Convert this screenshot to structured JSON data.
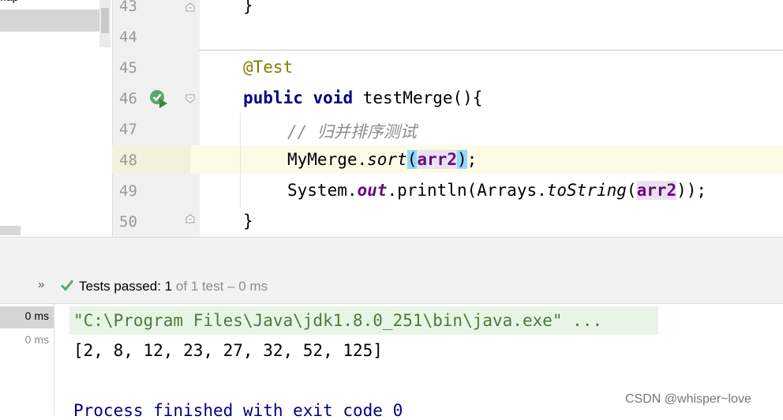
{
  "project_tree": {
    "partial_item": "nap"
  },
  "gutter": {
    "line_numbers": [
      "43",
      "44",
      "45",
      "46",
      "47",
      "48",
      "49",
      "50"
    ]
  },
  "editor": {
    "line43": {
      "brace": "}"
    },
    "line45": {
      "annotation": "@Test"
    },
    "line46": {
      "kw_public": "public",
      "kw_void": "void",
      "signature": " testMerge(){"
    },
    "line47": {
      "comment": "// 归并排序测试"
    },
    "line48": {
      "obj": "MyMerge.",
      "method": "sort",
      "lparen": "(",
      "arg": "arr2",
      "rparen": ")",
      "end": ";"
    },
    "line49": {
      "sys": "System.",
      "field": "out",
      "mid": ".println(Arrays.",
      "method": "toString",
      "lparen": "(",
      "arg": "arr2",
      "end": "));"
    },
    "line50": {
      "brace": "}"
    }
  },
  "test_status": {
    "passed_label": "Tests passed: ",
    "passed_count": "1",
    "rest": " of 1 test – 0 ms",
    "expand_glyph": "»"
  },
  "test_tree": {
    "times": [
      "0 ms",
      "0 ms"
    ]
  },
  "console": {
    "lines": [
      "\"C:\\Program Files\\Java\\jdk1.8.0_251\\bin\\java.exe\" ...",
      "[2, 8, 12, 23, 27, 32, 52, 125]",
      "Process finished with exit code 0"
    ]
  },
  "watermark": "CSDN @whisper~love",
  "colors": {
    "keyword": "#000080",
    "annotation": "#808000",
    "comment": "#8c8c8c",
    "field": "#660e7a",
    "passed_check": "#59a869"
  }
}
